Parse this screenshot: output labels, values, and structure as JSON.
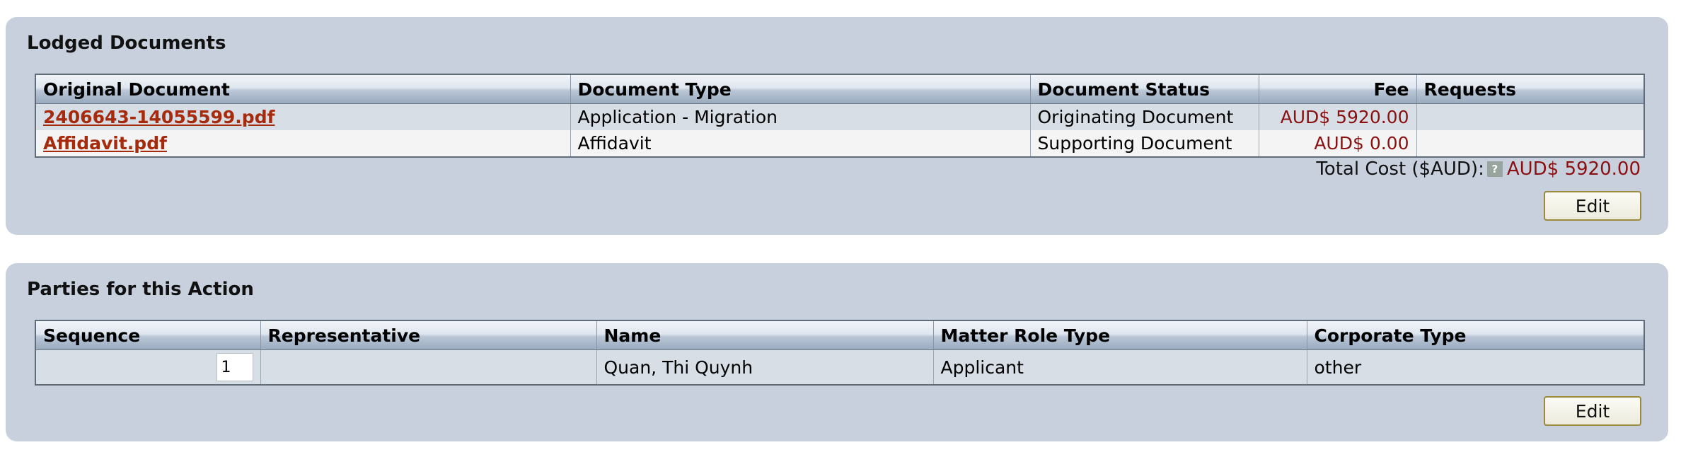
{
  "lodged": {
    "title": "Lodged Documents",
    "columns": [
      "Original Document",
      "Document Type",
      "Document Status",
      "Fee",
      "Requests"
    ],
    "rows": [
      {
        "document": "2406643-14055599.pdf",
        "type": "Application - Migration",
        "status": "Originating Document",
        "fee": "AUD$ 5920.00",
        "requests": ""
      },
      {
        "document": "Affidavit.pdf",
        "type": "Affidavit",
        "status": "Supporting Document",
        "fee": "AUD$ 0.00",
        "requests": ""
      }
    ],
    "total_label": "Total Cost ($AUD):",
    "help_icon": "?",
    "total_value": "AUD$ 5920.00",
    "edit_label": "Edit"
  },
  "parties": {
    "title": "Parties for this Action",
    "columns": [
      "Sequence",
      "Representative",
      "Name",
      "Matter Role Type",
      "Corporate Type"
    ],
    "rows": [
      {
        "sequence": "1",
        "representative": "",
        "name": "Quan, Thi Quynh",
        "role": "Applicant",
        "corporate": "other"
      }
    ],
    "edit_label": "Edit"
  },
  "colors": {
    "panel_bg": "#c7d0dc",
    "link": "#a62a0b",
    "fee": "#8b1111"
  }
}
